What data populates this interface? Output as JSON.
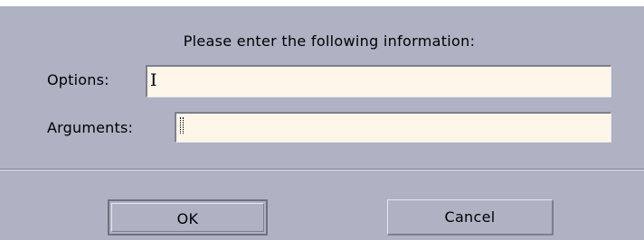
{
  "dialog": {
    "prompt": "Please enter the following information:",
    "fields": {
      "options": {
        "label": "Options:",
        "value": ""
      },
      "arguments": {
        "label": "Arguments:",
        "value": ""
      }
    },
    "buttons": {
      "ok_label": "OK",
      "cancel_label": "Cancel"
    }
  },
  "colors": {
    "background": "#aeb2c3",
    "field_background": "#fdf6e9"
  }
}
